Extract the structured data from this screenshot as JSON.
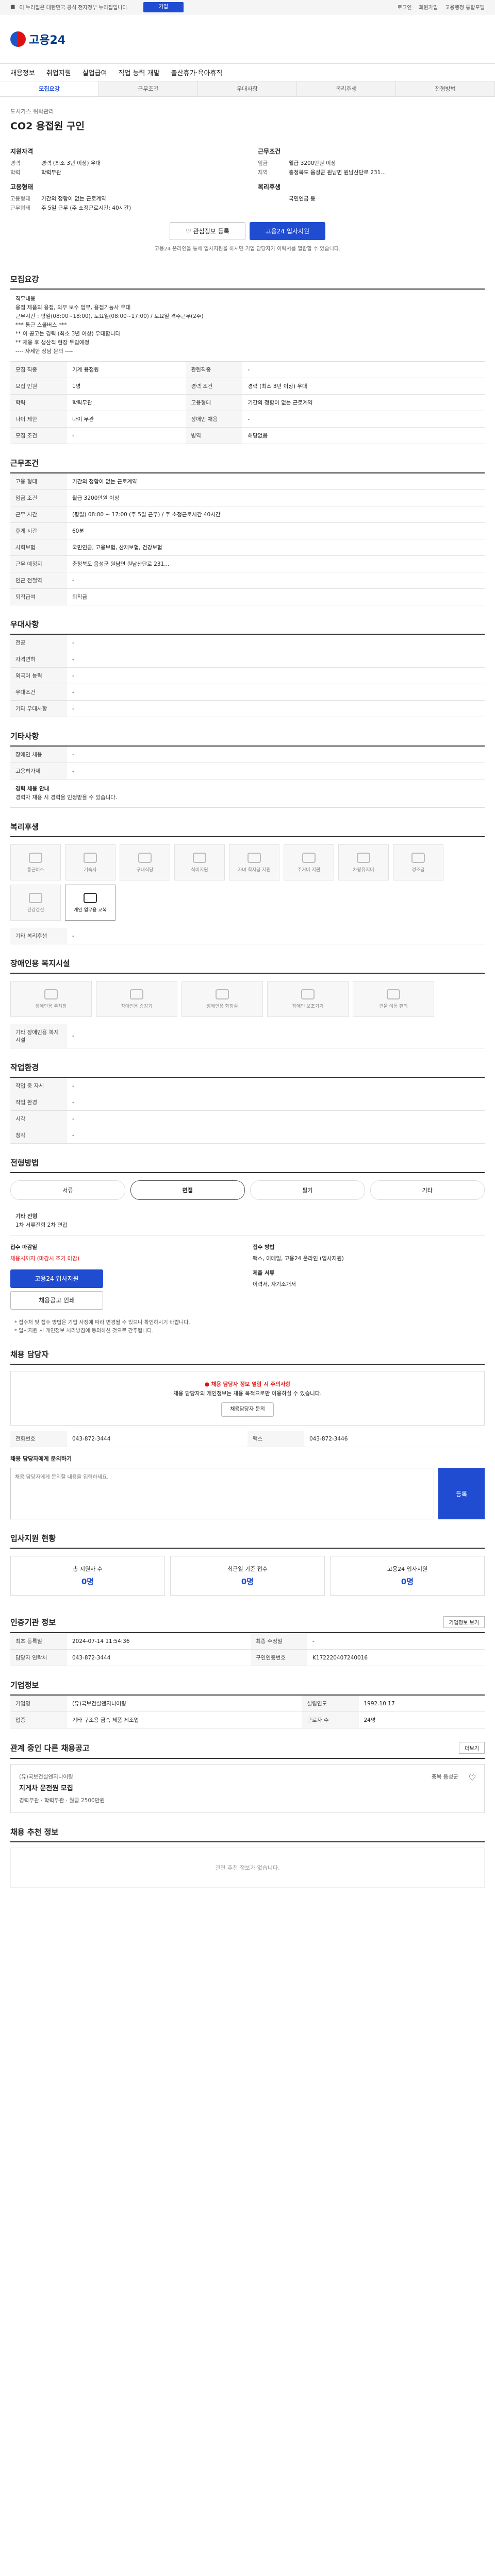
{
  "topbar": {
    "notice": "이 누리집은 대한민국 공식 전자정부 누리집입니다.",
    "tab": "기업",
    "links": [
      "로그인",
      "회원가입",
      "고용행정 통합포털"
    ]
  },
  "logo": {
    "text": "고용24"
  },
  "nav": [
    "채용정보",
    "취업지원",
    "실업급여",
    "직업 능력 개발",
    "출산휴가·육아휴직"
  ],
  "subnav": [
    "모집요강",
    "근무조건",
    "우대사항",
    "복리후생",
    "전형방법"
  ],
  "job": {
    "company": "도시가스 위탁관리",
    "title": "CO2 용접원 구인",
    "recruit_h": "지원자격",
    "recruit": [
      {
        "k": "경력",
        "v": "경력 (최소 3년 이상) 우대"
      },
      {
        "k": "학력",
        "v": "학력무관"
      }
    ],
    "cond_h": "근무조건",
    "cond": [
      {
        "k": "임금",
        "v": "월급 3200만원 이상"
      },
      {
        "k": "지역",
        "v": "충청북도 음성군 원남면 원남산단로 231..."
      }
    ],
    "form_h": "고용형태",
    "form": [
      {
        "k": "고용형태",
        "v": "기간의 정함이 없는 근로계약"
      },
      {
        "k": "근무형태",
        "v": "주 5일 근무 (주 소정근로시간: 40시간)"
      }
    ],
    "welfare_h": "복리후생",
    "welfare": [
      {
        "k": "",
        "v": "국민연금 등"
      }
    ]
  },
  "buttons": {
    "scrap": "관심정보 등록",
    "apply": "고용24 입사지원"
  },
  "apply_note": "고용24 온라인을 통해 입사지원을 하시면 기업 담당자가 이력서를 열람할 수 있습니다.",
  "recruit_section": {
    "title": "모집요강",
    "desc": "직무내용\n용접 제품의 용접, 외부 보수 업무, 용접기능사 우대\n근무시간 : 평일(08:00~18:00), 토요일(08:00~17:00) / 토요일 격주근무(2주)\n*** 통근 스쿨버스 ***\n** 이 공고는 경력 (최소 3년 이상) 우대합니다\n** 채용 후 생산직 현장 투입예정\n---- 자세한 상담 문의 ----",
    "rows": [
      {
        "k": "모집 직종",
        "v": "기계 용접원",
        "k2": "관련직종",
        "v2": "-"
      },
      {
        "k": "모집 인원",
        "v": "1명",
        "k2": "경력 조건",
        "v2": "경력 (최소 3년 이상) 우대"
      },
      {
        "k": "학력",
        "v": "학력무관",
        "k2": "고용형태",
        "v2": "기간의 정함이 없는 근로계약"
      },
      {
        "k": "나이 제한",
        "v": "나이 무관",
        "k2": "장애인 채용",
        "v2": "-"
      },
      {
        "k": "모집 조건",
        "v": "-",
        "k2": "병역",
        "v2": "해당없음"
      }
    ]
  },
  "work_section": {
    "title": "근무조건",
    "rows": [
      {
        "k": "고용 형태",
        "v": "기간의 정함이 없는 근로계약"
      },
      {
        "k": "임금 조건",
        "v": "월급 3200만원 이상"
      },
      {
        "k": "근무 시간",
        "v": "(평일) 08:00 ~ 17:00 (주 5일 근무) / 주 소정근로시간 40시간"
      },
      {
        "k": "휴게 시간",
        "v": "60분"
      },
      {
        "k": "사회보험",
        "v": "국민연금, 고용보험, 산재보험, 건강보험"
      },
      {
        "k": "근무 예정지",
        "v": "충청북도 음성군 원남면 원남산단로 231..."
      },
      {
        "k": "인근 전철역",
        "v": "-"
      },
      {
        "k": "퇴직급여",
        "v": "퇴직금"
      }
    ]
  },
  "prefer_section": {
    "title": "우대사항",
    "rows": [
      {
        "k": "전공",
        "v": "-"
      },
      {
        "k": "자격면허",
        "v": "-"
      },
      {
        "k": "외국어 능력",
        "v": "-"
      },
      {
        "k": "우대조건",
        "v": "-"
      },
      {
        "k": "기타 우대사항",
        "v": "-"
      }
    ]
  },
  "other_section": {
    "title": "기타사항",
    "rows": [
      {
        "k": "장애인 채용",
        "v": "-"
      },
      {
        "k": "고용허가제",
        "v": "-"
      }
    ],
    "note_h": "경력 채용 안내",
    "note": "경력자 채용 시 경력을 인정받을 수 있습니다."
  },
  "welfare_section": {
    "title": "복리후생",
    "tiles": [
      "통근버스",
      "기숙사",
      "구내식당",
      "식비지원",
      "자녀 학자금 지원",
      "주거비 지원",
      "차량유지비",
      "경조금",
      "건강검진",
      "개인 업무용 교복"
    ],
    "other_h": "기타 복리후생",
    "other": "-"
  },
  "disability_section": {
    "title": "장애인용 복지시설",
    "tiles": [
      "장애인용 주차장",
      "장애인용 승강기",
      "장애인용 화장실",
      "장애인 보조기기",
      "건물 이동 편의"
    ],
    "other_h": "기타 장애인용 복지시설",
    "other": "-"
  },
  "location_section": {
    "title": "작업환경",
    "rows": [
      {
        "k": "작업 중 자세",
        "v": "-",
        "k2": "",
        "v2": ""
      },
      {
        "k": "작업 환경",
        "v": "-",
        "k2": "",
        "v2": ""
      },
      {
        "k": "시각",
        "v": "-",
        "k2": "",
        "v2": ""
      },
      {
        "k": "청각",
        "v": "-",
        "k2": "",
        "v2": ""
      }
    ]
  },
  "selection_section": {
    "title": "전형방법",
    "steps": [
      "서류",
      "면접",
      "필기",
      "기타"
    ],
    "more_h": "기타 전형",
    "more": "1차 서류전형 2차 면접",
    "apply_h": "접수 마감일",
    "apply_v": "채용시까지 (마감시 조기 마감)",
    "method_h": "접수 방법",
    "method_v": "팩스, 이메일, 고용24 온라인 (입사지원)",
    "docs_h": "제출 서류",
    "docs_v": "이력서, 자기소개서",
    "apply_btn": "고용24 입사지원",
    "print_btn": "채용공고 인쇄",
    "bullets": [
      "* 접수처 및 접수 방법은 기업 사정에 따라 변경될 수 있으니 확인하시기 바랍니다.",
      "* 입사지원 시 개인정보 처리방침에 동의하신 것으로 간주됩니다."
    ]
  },
  "contact_section": {
    "title": "채용 담당자",
    "alert_title": "채용 담당자 정보 열람 시 주의사항",
    "alert_body": "채용 담당자의 개인정보는 채용 목적으로만 이용하실 수 있습니다.",
    "contact_btn": "채용담당자 문의",
    "phone": "043-872-3444",
    "fax": "043-872-3446",
    "qa_h": "채용 담당자에게 문의하기",
    "qa_placeholder": "채용 담당자에게 문의할 내용을 입력하세요.",
    "send": "등록"
  },
  "stats_section": {
    "title": "입사지원 현황",
    "stats": [
      {
        "label": "총 지원자 수",
        "value": "0명"
      },
      {
        "label": "최근일 기준 접수",
        "value": "0명"
      },
      {
        "label": "고용24 입사지원",
        "value": "0명"
      }
    ]
  },
  "info_section": {
    "title": "인증기관 정보",
    "btn": "기업정보 보기",
    "rows": [
      {
        "k": "최초 등록일",
        "v": "2024-07-14 11:54:36",
        "k2": "최종 수정일",
        "v2": "-"
      },
      {
        "k": "담당자 연락처",
        "v": "043-872-3444",
        "k2": "구인인증번호",
        "v2": "K172220407240016"
      }
    ]
  },
  "company_section": {
    "title": "기업정보",
    "rows": [
      {
        "k": "기업명",
        "v": "(유)국보건설엔지니어링",
        "k2": "설립연도",
        "v2": "1992.10.17"
      },
      {
        "k": "업종",
        "v": "기타 구조용 금속 제품 제조업",
        "k2": "근로자 수",
        "v2": "24명"
      }
    ]
  },
  "more_section": {
    "title": "관계 중인 다른 채용공고",
    "btn": "더보기",
    "job_company": "(유)국보건설엔지니어링",
    "job_title": "지게차 운전원 모집",
    "job_meta": "경력무관 · 학력무관 · 월급 2500만원",
    "region": "충북 음성군",
    "recommend_h": "채용 추천 정보",
    "empty": "관련 추천 정보가 없습니다."
  }
}
